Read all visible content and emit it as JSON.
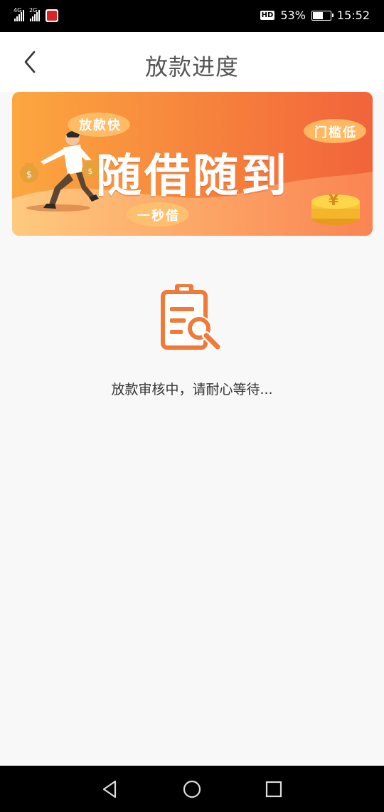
{
  "status_bar": {
    "network1": "4G",
    "network2": "2G",
    "battery_percent": "53%",
    "time": "15:52",
    "hd_label": "HD",
    "battery_level": 0.53
  },
  "header": {
    "title": "放款进度",
    "back_icon": "chevron-left-icon"
  },
  "banner": {
    "headline": "随借随到",
    "tag_fast": "放款快",
    "tag_low": "门槛低",
    "tag_second": "一秒借",
    "coin_symbol": "¥",
    "colors": {
      "start": "#fba53f",
      "end": "#f26a3d"
    }
  },
  "status": {
    "icon": "clipboard-search-icon",
    "message": "放款审核中，请耐心等待..."
  },
  "nav": {
    "back_icon": "triangle-back-icon",
    "home_icon": "circle-home-icon",
    "recent_icon": "square-recent-icon"
  },
  "accent_color": "#f07a3a"
}
